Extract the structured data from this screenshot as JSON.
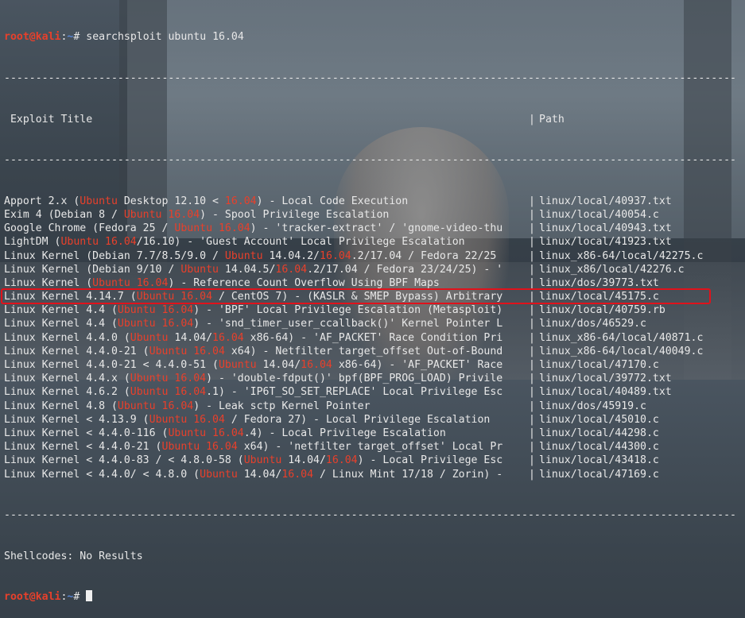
{
  "prompt": {
    "user": "root@kali",
    "path": "~",
    "symbol": "#",
    "command": "searchsploit ubuntu 16.04"
  },
  "divider": "--------------------------------------------------------------------------------------------------------------------",
  "headers": {
    "title": "Exploit Title",
    "path": "Path"
  },
  "rows": [
    {
      "segs": [
        [
          "Apport 2.x (",
          ""
        ],
        [
          "Ubuntu",
          "r"
        ],
        [
          " Desktop 12.10 < ",
          ""
        ],
        [
          "16.04",
          "r"
        ],
        [
          ") - Local Code Execution",
          ""
        ]
      ],
      "path": "linux/local/40937.txt"
    },
    {
      "segs": [
        [
          "Exim 4 (Debian 8 / ",
          ""
        ],
        [
          "Ubuntu 16.04",
          "r"
        ],
        [
          ") - Spool Privilege Escalation",
          ""
        ]
      ],
      "path": "linux/local/40054.c"
    },
    {
      "segs": [
        [
          "Google Chrome (Fedora 25 / ",
          ""
        ],
        [
          "Ubuntu 16.04",
          "r"
        ],
        [
          ") - 'tracker-extract' / 'gnome-video-thu",
          ""
        ]
      ],
      "path": "linux/local/40943.txt"
    },
    {
      "segs": [
        [
          "LightDM (",
          ""
        ],
        [
          "Ubuntu 16.04",
          "r"
        ],
        [
          "/16.10) - 'Guest Account' Local Privilege Escalation",
          ""
        ]
      ],
      "path": "linux/local/41923.txt"
    },
    {
      "segs": [
        [
          "Linux Kernel (Debian 7.7/8.5/9.0 / ",
          ""
        ],
        [
          "Ubuntu",
          "r"
        ],
        [
          " 14.04.2/",
          ""
        ],
        [
          "16.04",
          "r"
        ],
        [
          ".2/17.04 / Fedora 22/25",
          ""
        ]
      ],
      "path": "linux_x86-64/local/42275.c"
    },
    {
      "segs": [
        [
          "Linux Kernel (Debian 9/10 / ",
          ""
        ],
        [
          "Ubuntu",
          "r"
        ],
        [
          " 14.04.5/",
          ""
        ],
        [
          "16.04",
          "r"
        ],
        [
          ".2/17.04 / Fedora 23/24/25) - '",
          ""
        ]
      ],
      "path": "linux_x86/local/42276.c"
    },
    {
      "segs": [
        [
          "Linux Kernel (",
          ""
        ],
        [
          "Ubuntu 16.04",
          "r"
        ],
        [
          ") - Reference Count Overflow Using BPF Maps",
          ""
        ]
      ],
      "path": "linux/dos/39773.txt"
    },
    {
      "segs": [
        [
          "Linux Kernel 4.14.7 (",
          ""
        ],
        [
          "Ubuntu 16.04",
          "r"
        ],
        [
          " / CentOS 7) - (KASLR & SMEP Bypass) Arbitrary",
          ""
        ]
      ],
      "path": "linux/local/45175.c"
    },
    {
      "segs": [
        [
          "Linux Kernel 4.4 (",
          ""
        ],
        [
          "Ubuntu 16.04",
          "r"
        ],
        [
          ") - 'BPF' Local Privilege Escalation (Metasploit)",
          ""
        ]
      ],
      "path": "linux/local/40759.rb"
    },
    {
      "segs": [
        [
          "Linux Kernel 4.4 (",
          ""
        ],
        [
          "Ubuntu 16.04",
          "r"
        ],
        [
          ") - 'snd_timer_user_ccallback()' Kernel Pointer L",
          ""
        ]
      ],
      "path": "linux/dos/46529.c"
    },
    {
      "segs": [
        [
          "Linux Kernel 4.4.0 (",
          ""
        ],
        [
          "Ubuntu",
          "r"
        ],
        [
          " 14.04/",
          ""
        ],
        [
          "16.04",
          "r"
        ],
        [
          " x86-64) - 'AF_PACKET' Race Condition Pri",
          ""
        ]
      ],
      "path": "linux_x86-64/local/40871.c"
    },
    {
      "segs": [
        [
          "Linux Kernel 4.4.0-21 (",
          ""
        ],
        [
          "Ubuntu 16.04",
          "r"
        ],
        [
          " x64) - Netfilter target_offset Out-of-Bound",
          ""
        ]
      ],
      "path": "linux_x86-64/local/40049.c"
    },
    {
      "segs": [
        [
          "Linux Kernel 4.4.0-21 < 4.4.0-51 (",
          ""
        ],
        [
          "Ubuntu",
          "r"
        ],
        [
          " 14.04/",
          ""
        ],
        [
          "16.04",
          "r"
        ],
        [
          " x86-64) - 'AF_PACKET' Race",
          ""
        ]
      ],
      "path": "linux/local/47170.c"
    },
    {
      "segs": [
        [
          "Linux Kernel 4.4.x (",
          ""
        ],
        [
          "Ubuntu 16.04",
          "r"
        ],
        [
          ") - 'double-fdput()' bpf(BPF_PROG_LOAD) Privile",
          ""
        ]
      ],
      "path": "linux/local/39772.txt"
    },
    {
      "segs": [
        [
          "Linux Kernel 4.6.2 (",
          ""
        ],
        [
          "Ubuntu 16.04",
          "r"
        ],
        [
          ".1) - 'IP6T_SO_SET_REPLACE' Local Privilege Esc",
          ""
        ]
      ],
      "path": "linux/local/40489.txt"
    },
    {
      "segs": [
        [
          "Linux Kernel 4.8 (",
          ""
        ],
        [
          "Ubuntu 16.04",
          "r"
        ],
        [
          ") - Leak sctp Kernel Pointer",
          ""
        ]
      ],
      "path": "linux/dos/45919.c"
    },
    {
      "segs": [
        [
          "Linux Kernel < 4.13.9 (",
          ""
        ],
        [
          "Ubuntu 16.04",
          "r"
        ],
        [
          " / Fedora 27) - Local Privilege Escalation",
          ""
        ]
      ],
      "path": "linux/local/45010.c"
    },
    {
      "segs": [
        [
          "Linux Kernel < 4.4.0-116 (",
          ""
        ],
        [
          "Ubuntu 16.04",
          "r"
        ],
        [
          ".4) - Local Privilege Escalation",
          ""
        ]
      ],
      "path": "linux/local/44298.c"
    },
    {
      "segs": [
        [
          "Linux Kernel < 4.4.0-21 (",
          ""
        ],
        [
          "Ubuntu 16.04",
          "r"
        ],
        [
          " x64) - 'netfilter target_offset' Local Pr",
          ""
        ]
      ],
      "path": "linux/local/44300.c"
    },
    {
      "segs": [
        [
          "Linux Kernel < 4.4.0-83 / < 4.8.0-58 (",
          ""
        ],
        [
          "Ubuntu",
          "r"
        ],
        [
          " 14.04/",
          ""
        ],
        [
          "16.04",
          "r"
        ],
        [
          ") - Local Privilege Esc",
          ""
        ]
      ],
      "path": "linux/local/43418.c"
    },
    {
      "segs": [
        [
          "Linux Kernel < 4.4.0/ < 4.8.0 (",
          ""
        ],
        [
          "Ubuntu",
          "r"
        ],
        [
          " 14.04/",
          ""
        ],
        [
          "16.04",
          "r"
        ],
        [
          " / Linux Mint 17/18 / Zorin) - ",
          ""
        ]
      ],
      "path": "linux/local/47169.c"
    }
  ],
  "shellcodes": "Shellcodes: No Results",
  "colors": {
    "accent_red": "#e8402b",
    "highlight_box": "#e0121b",
    "prompt_path": "#5a87d6"
  }
}
